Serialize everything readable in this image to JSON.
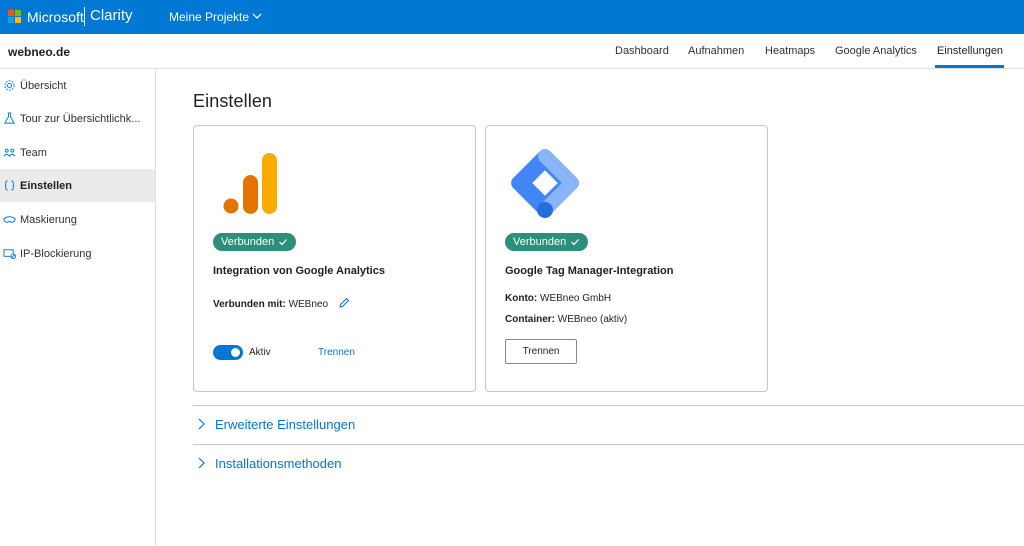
{
  "colors": {
    "brand_blue": "#0078d4",
    "badge_green": "#2d8f7b",
    "ga_orange_dark": "#e37400",
    "ga_orange_light": "#f9ab00",
    "gtm_blue": "#4285f4",
    "gtm_light": "#8ab4f8"
  },
  "topbar": {
    "brand": "Microsoft",
    "product": "Clarity",
    "projects_label": "Meine Projekte",
    "projects_icon": "chevron-down-icon"
  },
  "subheader": {
    "site_name": "webneo.de",
    "nav": [
      {
        "label": "Dashboard"
      },
      {
        "label": "Aufnahmen"
      },
      {
        "label": "Heatmaps"
      },
      {
        "label": "Google Analytics"
      },
      {
        "label": "Einstellungen",
        "active": true
      }
    ]
  },
  "sidebar": {
    "items": [
      {
        "label": "Übersicht",
        "icon": "gear-icon"
      },
      {
        "label": "Tour zur Übersichtlichk...",
        "icon": "flask-icon"
      },
      {
        "label": "Team",
        "icon": "team-icon"
      },
      {
        "label": "Einstellen",
        "icon": "braces-icon",
        "active": true
      },
      {
        "label": "Maskierung",
        "icon": "mask-icon"
      },
      {
        "label": "IP-Blockierung",
        "icon": "ip-block-icon"
      }
    ]
  },
  "main": {
    "title": "Einstellen",
    "cards": [
      {
        "logo_icon": "google-analytics-icon",
        "badge": "Verbunden",
        "title": "Integration von Google Analytics",
        "connected_key": "Verbunden mit:",
        "connected_value": "WEBneo",
        "toggle_on": true,
        "toggle_label": "Aktiv",
        "link_label": "Trennen"
      },
      {
        "logo_icon": "google-tag-manager-icon",
        "badge": "Verbunden",
        "title": "Google Tag Manager-Integration",
        "account_key": "Konto:",
        "account_value": "WEBneo GmbH",
        "container_key": "Container:",
        "container_value": "WEBneo (aktiv)",
        "button_label": "Trennen"
      }
    ],
    "expanders": [
      {
        "label": "Erweiterte Einstellungen"
      },
      {
        "label": "Installationsmethoden"
      }
    ]
  }
}
